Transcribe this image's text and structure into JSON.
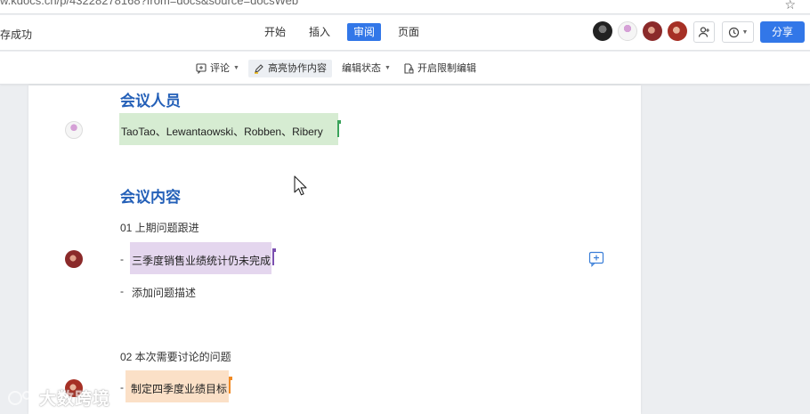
{
  "browser": {
    "url": "w.kdocs.cn/p/43228278168?from=docs&source=docsWeb"
  },
  "menubar": {
    "save_status": "存成功",
    "tabs": [
      {
        "label": "开始",
        "active": false
      },
      {
        "label": "插入",
        "active": false
      },
      {
        "label": "审阅",
        "active": true
      },
      {
        "label": "页面",
        "active": false
      }
    ],
    "share_label": "分享"
  },
  "toolbar": {
    "comment_label": "评论",
    "highlight_label": "高亮协作内容",
    "edit_state_label": "编辑状态",
    "restrict_label": "开启限制编辑"
  },
  "doc": {
    "section1_title": "会议人员",
    "attendees": "TaoTao、Lewantaowski、Robben、Ribery",
    "section2_title": "会议内容",
    "item1_heading": "01 上期问题跟进",
    "item1_bullet1": "三季度销售业绩统计仍未完成",
    "item1_bullet2": "添加问题描述",
    "item2_heading": "02 本次需要讨论的问题",
    "item2_bullet1": "制定四季度业绩目标",
    "dash": "-"
  },
  "watermark": {
    "text": "大数跨境"
  },
  "colors": {
    "accent": "#3277e8",
    "heading": "#2460b8",
    "highlight_green": "#d6ecd2",
    "highlight_purple": "#e4d6ee",
    "highlight_orange": "#fbe0c7"
  }
}
